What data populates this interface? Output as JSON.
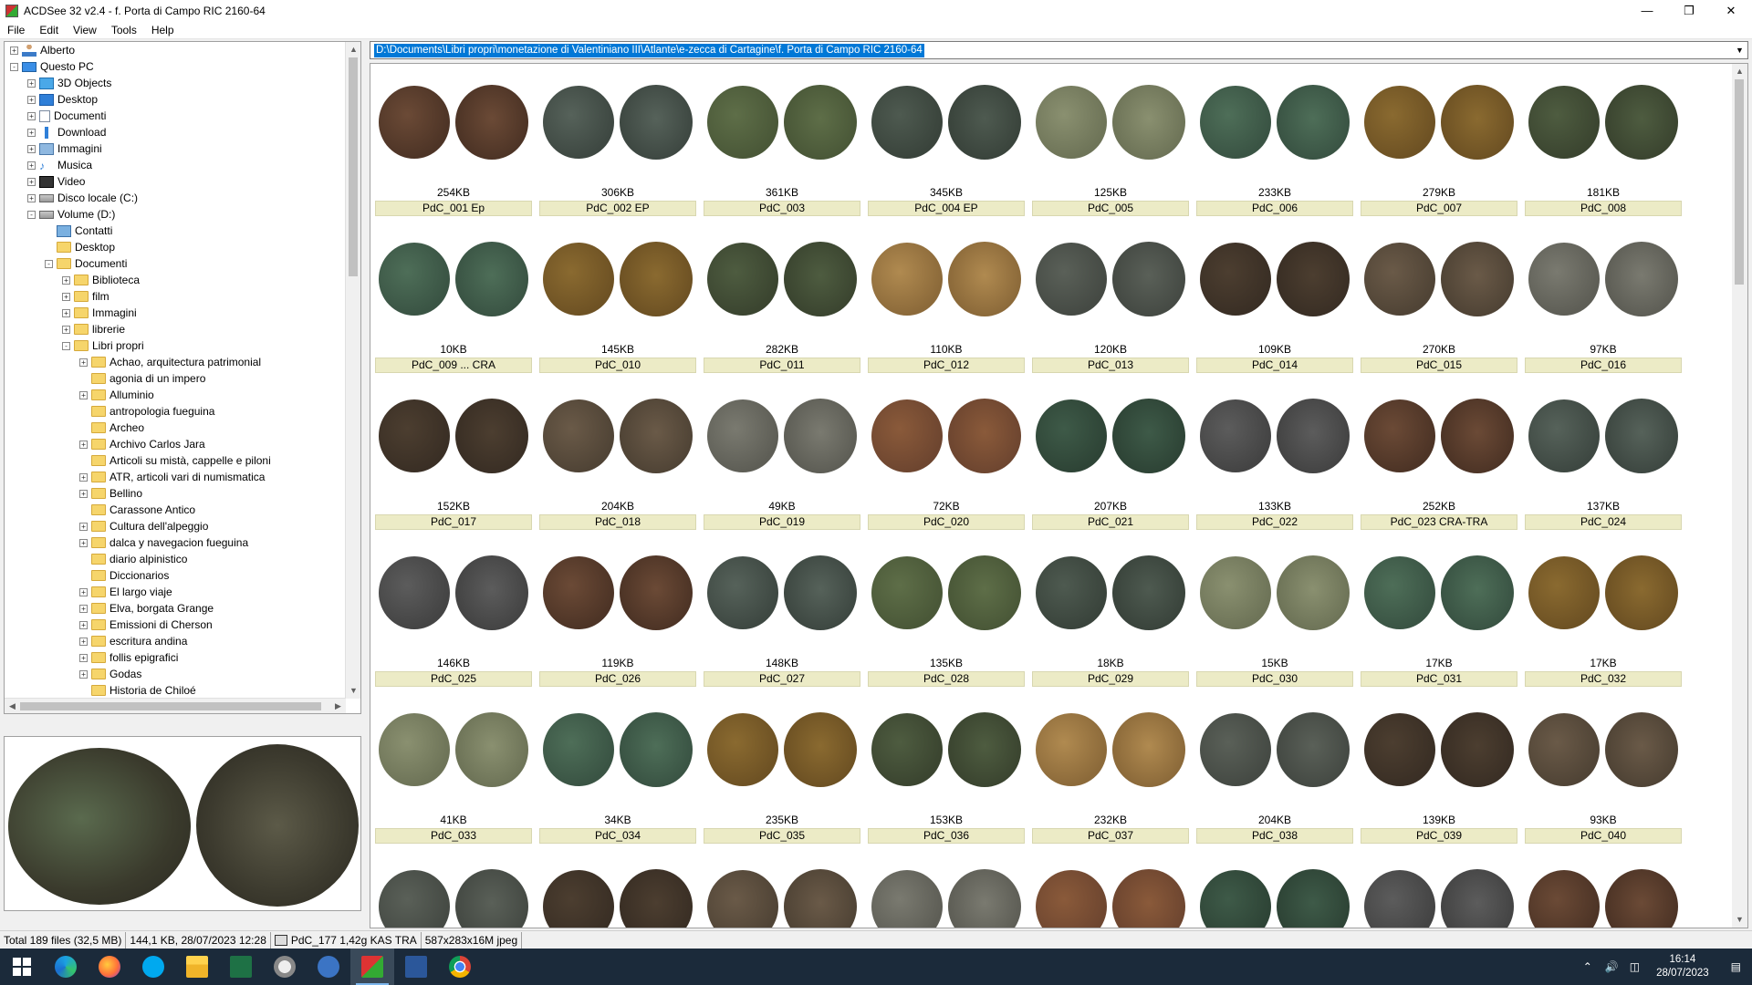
{
  "window": {
    "title": "ACDSee 32 v2.4 - f. Porta di Campo RIC 2160-64"
  },
  "menu": [
    "File",
    "Edit",
    "View",
    "Tools",
    "Help"
  ],
  "address": "D:\\Documents\\Libri propri\\monetazione di Valentiniano III\\Atlante\\e-zecca di Cartagine\\f. Porta di Campo RIC 2160-64",
  "tree": [
    {
      "label": "Alberto",
      "icon": "user-icon"
    },
    {
      "label": "Questo PC",
      "icon": "pc-icon"
    },
    {
      "label": "3D Objects",
      "icon": "cube-icon"
    },
    {
      "label": "Desktop",
      "icon": "desktop-icon"
    },
    {
      "label": "Documenti",
      "icon": "document-icon"
    },
    {
      "label": "Download",
      "icon": "download-icon"
    },
    {
      "label": "Immagini",
      "icon": "pictures-icon"
    },
    {
      "label": "Musica",
      "icon": "music-icon"
    },
    {
      "label": "Video",
      "icon": "video-icon"
    },
    {
      "label": "Disco locale (C:)",
      "icon": "disk-icon"
    },
    {
      "label": "Volume (D:)",
      "icon": "disk-icon"
    },
    {
      "label": "Contatti",
      "icon": "contacts-icon"
    },
    {
      "label": "Desktop",
      "icon": "folder-icon"
    },
    {
      "label": "Documenti",
      "icon": "folder-icon"
    },
    {
      "label": "Biblioteca",
      "icon": "folder-icon"
    },
    {
      "label": "film",
      "icon": "folder-icon"
    },
    {
      "label": "Immagini",
      "icon": "folder-icon"
    },
    {
      "label": "librerie",
      "icon": "folder-icon"
    },
    {
      "label": "Libri propri",
      "icon": "folder-icon"
    },
    {
      "label": "Achao, arquitectura patrimonial",
      "icon": "folder-icon"
    },
    {
      "label": "agonia di un impero",
      "icon": "folder-icon"
    },
    {
      "label": "Alluminio",
      "icon": "folder-icon"
    },
    {
      "label": "antropologia fueguina",
      "icon": "folder-icon"
    },
    {
      "label": "Archeo",
      "icon": "folder-icon"
    },
    {
      "label": "Archivo Carlos Jara",
      "icon": "folder-icon"
    },
    {
      "label": "Articoli su mistà, cappelle e piloni",
      "icon": "folder-icon"
    },
    {
      "label": "ATR, articoli vari di numismatica",
      "icon": "folder-icon"
    },
    {
      "label": "Bellino",
      "icon": "folder-icon"
    },
    {
      "label": "Carassone Antico",
      "icon": "folder-icon"
    },
    {
      "label": "Cultura dell'alpeggio",
      "icon": "folder-icon"
    },
    {
      "label": "dalca y navegacion fueguina",
      "icon": "folder-icon"
    },
    {
      "label": "diario alpinistico",
      "icon": "folder-icon"
    },
    {
      "label": "Diccionarios",
      "icon": "folder-icon"
    },
    {
      "label": "El largo viaje",
      "icon": "folder-icon"
    },
    {
      "label": "Elva, borgata Grange",
      "icon": "folder-icon"
    },
    {
      "label": "Emissioni di Cherson",
      "icon": "folder-icon"
    },
    {
      "label": "escritura andina",
      "icon": "folder-icon"
    },
    {
      "label": "follis epigrafici",
      "icon": "folder-icon"
    },
    {
      "label": "Godas",
      "icon": "folder-icon"
    },
    {
      "label": "Historia de Chiloé",
      "icon": "folder-icon"
    }
  ],
  "thumbnails": [
    {
      "size": "254KB",
      "name": "PdC_001 Ep"
    },
    {
      "size": "306KB",
      "name": "PdC_002 EP"
    },
    {
      "size": "361KB",
      "name": "PdC_003"
    },
    {
      "size": "345KB",
      "name": "PdC_004 EP"
    },
    {
      "size": "125KB",
      "name": "PdC_005"
    },
    {
      "size": "233KB",
      "name": "PdC_006"
    },
    {
      "size": "279KB",
      "name": "PdC_007"
    },
    {
      "size": "181KB",
      "name": "PdC_008"
    },
    {
      "size": "10KB",
      "name": "PdC_009 ... CRA"
    },
    {
      "size": "145KB",
      "name": "PdC_010"
    },
    {
      "size": "282KB",
      "name": "PdC_011"
    },
    {
      "size": "110KB",
      "name": "PdC_012"
    },
    {
      "size": "120KB",
      "name": "PdC_013"
    },
    {
      "size": "109KB",
      "name": "PdC_014"
    },
    {
      "size": "270KB",
      "name": "PdC_015"
    },
    {
      "size": "97KB",
      "name": "PdC_016"
    },
    {
      "size": "152KB",
      "name": "PdC_017"
    },
    {
      "size": "204KB",
      "name": "PdC_018"
    },
    {
      "size": "49KB",
      "name": "PdC_019"
    },
    {
      "size": "72KB",
      "name": "PdC_020"
    },
    {
      "size": "207KB",
      "name": "PdC_021"
    },
    {
      "size": "133KB",
      "name": "PdC_022"
    },
    {
      "size": "252KB",
      "name": "PdC_023 CRA-TRA"
    },
    {
      "size": "137KB",
      "name": "PdC_024"
    },
    {
      "size": "146KB",
      "name": "PdC_025"
    },
    {
      "size": "119KB",
      "name": "PdC_026"
    },
    {
      "size": "148KB",
      "name": "PdC_027"
    },
    {
      "size": "135KB",
      "name": "PdC_028"
    },
    {
      "size": "18KB",
      "name": "PdC_029"
    },
    {
      "size": "15KB",
      "name": "PdC_030"
    },
    {
      "size": "17KB",
      "name": "PdC_031"
    },
    {
      "size": "17KB",
      "name": "PdC_032"
    },
    {
      "size": "41KB",
      "name": "PdC_033"
    },
    {
      "size": "34KB",
      "name": "PdC_034"
    },
    {
      "size": "235KB",
      "name": "PdC_035"
    },
    {
      "size": "153KB",
      "name": "PdC_036"
    },
    {
      "size": "232KB",
      "name": "PdC_037"
    },
    {
      "size": "204KB",
      "name": "PdC_038"
    },
    {
      "size": "139KB",
      "name": "PdC_039"
    },
    {
      "size": "93KB",
      "name": "PdC_040"
    }
  ],
  "status": {
    "total": "Total 189 files (32,5 MB)",
    "selected_info": "144,1 KB, 28/07/2023 12:28",
    "selected_name": "PdC_177 1,42g KAS TRA",
    "image_info": "587x283x16M jpeg"
  },
  "taskbar": {
    "time": "16:14",
    "date": "28/07/2023",
    "apps": [
      "windows-start-icon",
      "edge-icon",
      "firefox-icon",
      "skype-icon",
      "file-explorer-icon",
      "excel-icon",
      "network-icon",
      "media-icon",
      "acdsee-icon",
      "word-icon",
      "chrome-icon"
    ]
  },
  "colors": {
    "label_bg": "#ecebc6",
    "selection": "#0078d7",
    "taskbar": "#1b2a3a"
  }
}
